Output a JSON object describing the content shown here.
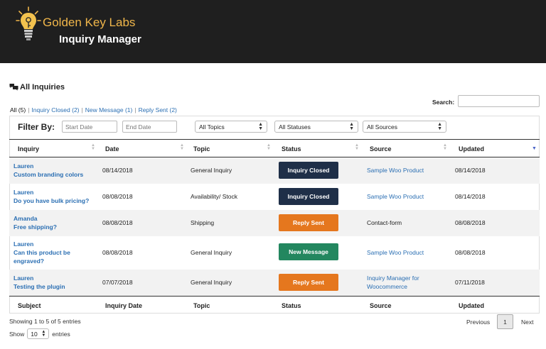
{
  "header": {
    "brand": "Golden Key Labs",
    "app_title": "Inquiry Manager"
  },
  "page": {
    "heading": "All Inquiries",
    "heading_icon": "chat-bubbles-icon"
  },
  "search": {
    "label": "Search:",
    "value": ""
  },
  "status_filter": {
    "all": "All (5)",
    "closed": "Inquiry Closed (2)",
    "new": "New Message (1)",
    "reply": "Reply Sent (2)",
    "separator": "|"
  },
  "filters": {
    "label": "Filter By:",
    "start_placeholder": "Start Date",
    "end_placeholder": "End Date",
    "topics": "All Topics",
    "statuses": "All Statuses",
    "sources": "All Sources"
  },
  "columns": {
    "inquiry": "Inquiry",
    "date": "Date",
    "topic": "Topic",
    "status": "Status",
    "source": "Source",
    "updated": "Updated"
  },
  "footer_columns": {
    "subject": "Subject",
    "date": "Inquiry Date",
    "topic": "Topic",
    "status": "Status",
    "source": "Source",
    "updated": "Updated"
  },
  "rows": [
    {
      "name": "Lauren",
      "subject": "Custom branding colors",
      "date": "08/14/2018",
      "topic": "General Inquiry",
      "status": "Inquiry Closed",
      "status_color": "#1f2f48",
      "source": "Sample Woo Product",
      "source_is_link": true,
      "updated": "08/14/2018"
    },
    {
      "name": "Lauren",
      "subject": "Do you have bulk pricing?",
      "date": "08/08/2018",
      "topic": "Availability/ Stock",
      "status": "Inquiry Closed",
      "status_color": "#1f2f48",
      "source": "Sample Woo Product",
      "source_is_link": true,
      "updated": "08/14/2018"
    },
    {
      "name": "Amanda",
      "subject": "Free shipping?",
      "date": "08/08/2018",
      "topic": "Shipping",
      "status": "Reply Sent",
      "status_color": "#e5771e",
      "source": "Contact-form",
      "source_is_link": false,
      "updated": "08/08/2018"
    },
    {
      "name": "Lauren",
      "subject": "Can this product be engraved?",
      "date": "08/08/2018",
      "topic": "General Inquiry",
      "status": "New Message",
      "status_color": "#23875f",
      "source": "Sample Woo Product",
      "source_is_link": true,
      "updated": "08/08/2018"
    },
    {
      "name": "Lauren",
      "subject": "Testing the plugin",
      "date": "07/07/2018",
      "topic": "General Inquiry",
      "status": "Reply Sent",
      "status_color": "#e5771e",
      "source": "Inquiry Manager for Woocommerce",
      "source_is_link": true,
      "updated": "07/11/2018"
    }
  ],
  "table_info": {
    "showing": "Showing 1 to 5 of 5 entries",
    "show_label": "Show",
    "page_length": "10",
    "entries_label": "entries"
  },
  "pagination": {
    "previous": "Previous",
    "current": "1",
    "next": "Next"
  },
  "colors": {
    "header_bg": "#1f1f1f",
    "brand": "#f0b64a",
    "link": "#2b6fb3"
  }
}
